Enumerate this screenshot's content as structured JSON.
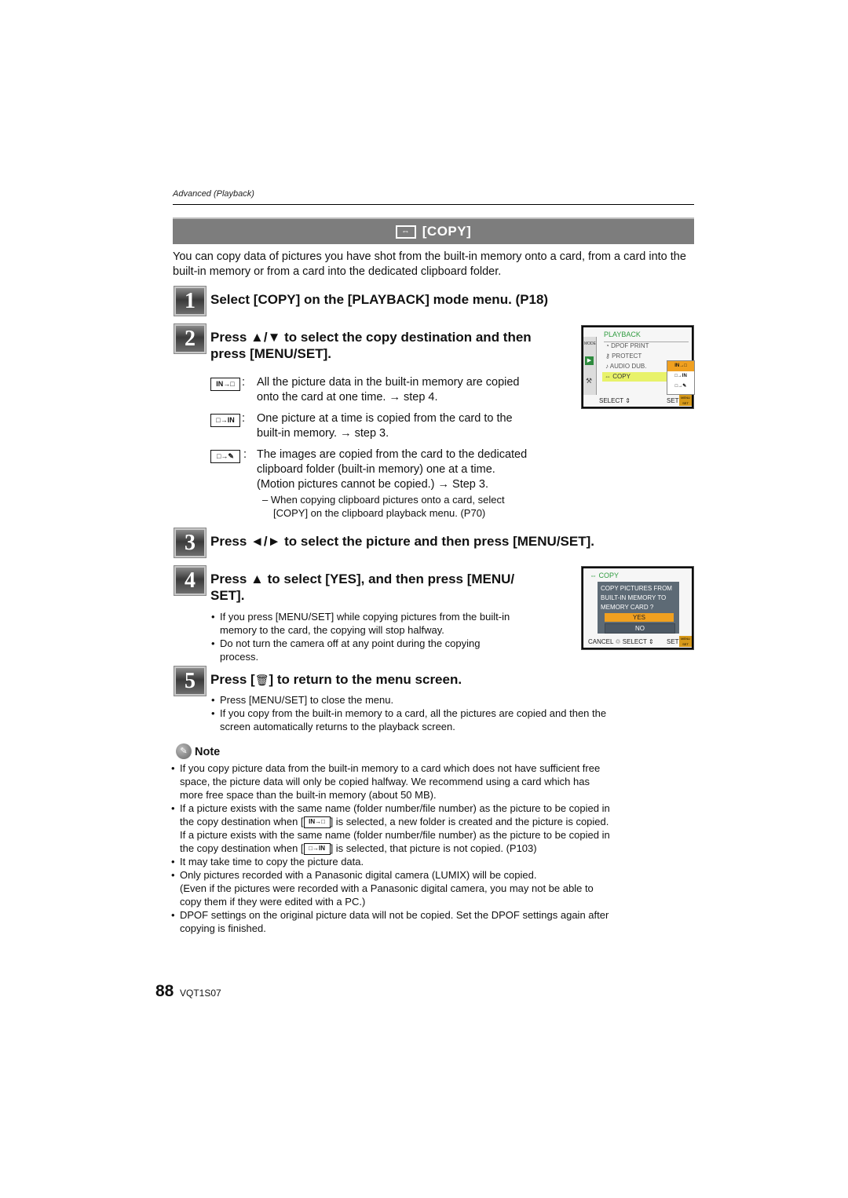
{
  "header": {
    "section": "Advanced (Playback)",
    "title_icon": "copy-icon",
    "title": "[COPY]"
  },
  "intro": "You can copy data of pictures you have shot from the built-in memory onto a card, from a card into the built-in memory or from a card into the dedicated clipboard folder.",
  "steps": [
    {
      "number": "1",
      "title": "Select [COPY] on the [PLAYBACK] mode menu. (P18)"
    },
    {
      "number": "2",
      "title_line1": "Press ▲/▼ to select the copy destination and then",
      "title_line2": "press [MENU/SET]."
    },
    {
      "number": "3",
      "title": "Press ◄/► to select the picture and then press [MENU/SET]."
    },
    {
      "number": "4",
      "title_line1": "Press ▲ to select [YES], and then press [MENU/",
      "title_line2": "SET]."
    },
    {
      "number": "5",
      "title_prefix": "Press [",
      "title_suffix": "] to return to the menu screen."
    }
  ],
  "options": [
    {
      "icon": "in-to-card-icon",
      "icon_text": "IN→□",
      "line1": "All the picture data in the built-in memory are copied",
      "line2": "onto the card at one time. → step 4."
    },
    {
      "icon": "card-to-in-icon",
      "icon_text": "□→IN",
      "line1": "One picture at a time is copied from the card to the",
      "line2": "built-in memory. → step 3."
    },
    {
      "icon": "card-to-clipboard-icon",
      "icon_text": "□→✎",
      "line1": "The images are copied from the card to the dedicated",
      "line2": "clipboard folder (built-in memory) one at a time.",
      "line3": "(Motion pictures cannot be copied.) → Step 3.",
      "sub1": "– When copying clipboard pictures onto a card, select",
      "sub2": "[COPY] on the clipboard playback menu. (P70)"
    }
  ],
  "screen1": {
    "header": "PLAYBACK",
    "tabs": [
      "MODE",
      "▶",
      "⚒"
    ],
    "items": [
      "DPOF PRINT",
      "PROTECT",
      "AUDIO DUB.",
      "COPY"
    ],
    "submenu": [
      "IN→□",
      "□→IN",
      "□→✎"
    ],
    "footer_left": "SELECT ⇕",
    "footer_right": "SET",
    "footer_badge": "MENU SET"
  },
  "screen2": {
    "header": "COPY",
    "message": [
      "COPY PICTURES FROM",
      "BUILT-IN MEMORY TO",
      "MEMORY CARD ?"
    ],
    "yes": "YES",
    "no": "NO",
    "footer": "CANCEL ♲ SELECT ⇕",
    "footer_right": "SET",
    "footer_badge": "MENU SET"
  },
  "step4_bullets": [
    {
      "line1": "If you press [MENU/SET] while copying pictures from the built-in",
      "line2": "memory to the card, the copying will stop halfway."
    },
    {
      "line1": "Do not turn the camera off at any point during the copying",
      "line2": "process."
    }
  ],
  "step5_bullets": [
    {
      "line1": "Press [MENU/SET] to close the menu."
    },
    {
      "line1": "If you copy from the built-in memory to a card, all the pictures are copied and then the",
      "line2": "screen automatically returns to the playback screen."
    }
  ],
  "note": {
    "title": "Note",
    "items": [
      {
        "lines": [
          "If you copy picture data from the built-in memory to a card which does not have sufficient free",
          "space, the picture data will only be copied halfway. We recommend using a card which has",
          "more free space than the built-in memory (about 50 MB)."
        ]
      },
      {
        "l1": "If a picture exists with the same name (folder number/file number) as the picture to be copied in",
        "l2a": "the copy destination when [",
        "l2b": "] is selected, a new folder is created and the picture is copied.",
        "l3": "If a picture exists with the same name (folder number/file number) as the picture to be copied in",
        "l4a": "the copy destination when [",
        "l4b": "] is selected, that picture is not copied. (P103)"
      },
      {
        "lines": [
          "It may take time to copy the picture data."
        ]
      },
      {
        "lines": [
          "Only pictures recorded with a Panasonic digital camera (LUMIX) will be copied.",
          "(Even if the pictures were recorded with a Panasonic digital camera, you may not be able to",
          "copy them if they were edited with a PC.)"
        ]
      },
      {
        "lines": [
          "DPOF settings on the original picture data will not be copied. Set the DPOF settings again after",
          "copying is finished."
        ]
      }
    ]
  },
  "footer": {
    "page_number": "88",
    "doc_code": "VQT1S07"
  }
}
